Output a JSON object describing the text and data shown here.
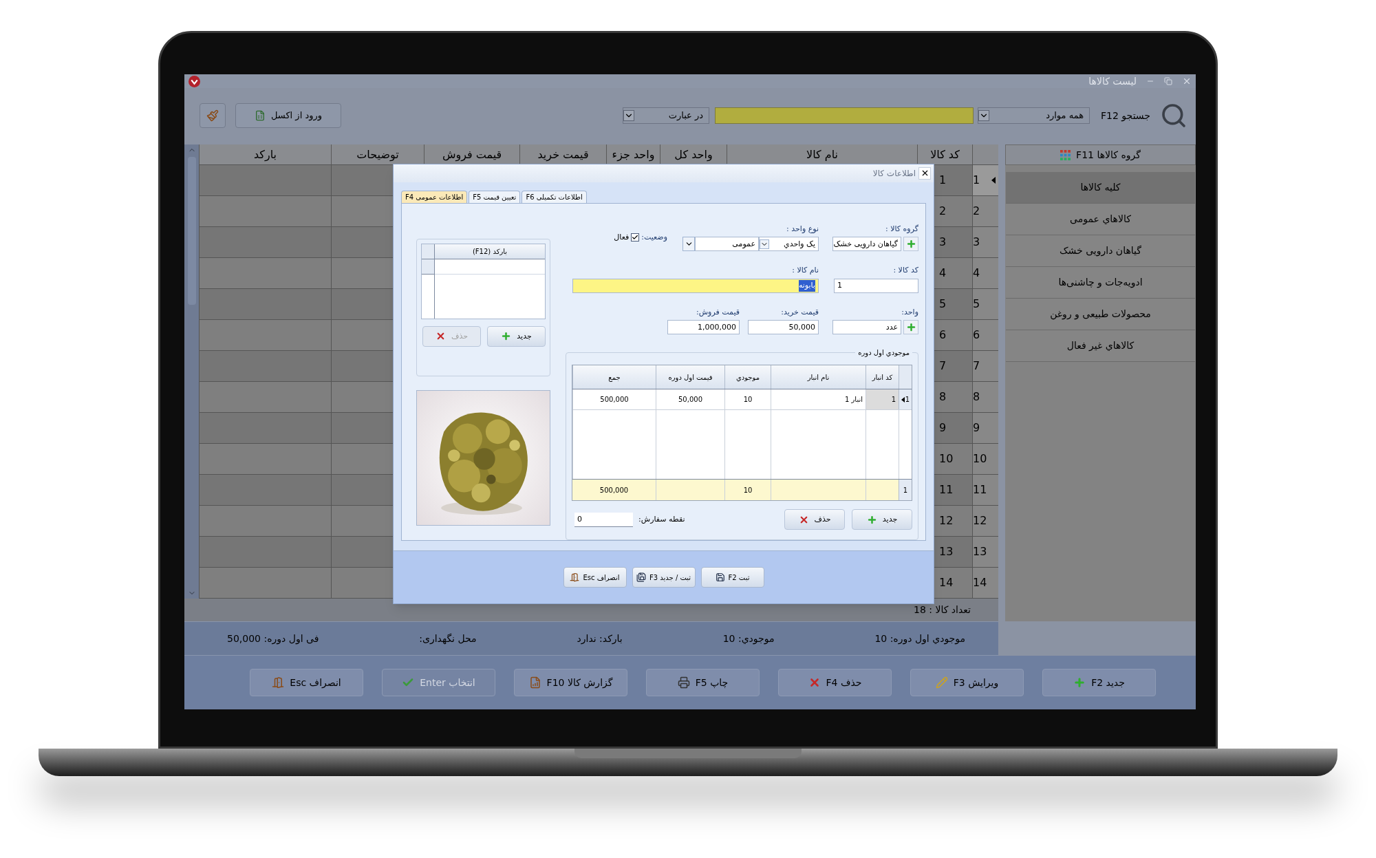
{
  "window": {
    "title": "لیست کالاها"
  },
  "toolbar": {
    "search_label": "جستجو F12",
    "scope": "همه موارد",
    "match": "در عبارت",
    "import_button": "ورود از اکسل"
  },
  "table": {
    "columns": [
      "کد کالا",
      "نام کالا",
      "واحد کل",
      "واحد جزء",
      "قیمت خرید",
      "قیمت فروش",
      "توضیحات",
      "بارکد"
    ],
    "rows": [
      {
        "number": "1",
        "code": "1",
        "selected": true
      },
      {
        "number": "2",
        "code": "2",
        "selected": false
      },
      {
        "number": "3",
        "code": "3",
        "selected": false
      },
      {
        "number": "4",
        "code": "4",
        "selected": false
      },
      {
        "number": "5",
        "code": "5",
        "selected": false
      },
      {
        "number": "6",
        "code": "6",
        "selected": false
      },
      {
        "number": "7",
        "code": "7",
        "selected": false
      },
      {
        "number": "8",
        "code": "8",
        "selected": false
      },
      {
        "number": "9",
        "code": "9",
        "selected": false
      },
      {
        "number": "10",
        "code": "10",
        "selected": false
      },
      {
        "number": "11",
        "code": "11",
        "selected": false
      },
      {
        "number": "12",
        "code": "12",
        "selected": false
      },
      {
        "number": "13",
        "code": "13",
        "selected": false
      },
      {
        "number": "14",
        "code": "14",
        "selected": false
      }
    ],
    "footer": "تعداد کالا : 18"
  },
  "sidebar": {
    "title": "گروه کالاها F11",
    "items": [
      {
        "label": "کلیه کالاها",
        "selected": true
      },
      {
        "label": "کالاهاي عمومی",
        "selected": false
      },
      {
        "label": "گیاهان دارویی خشک",
        "selected": false
      },
      {
        "label": "ادویه‌جات و چاشنی‌ها",
        "selected": false
      },
      {
        "label": "محصولات طبیعی و روغن",
        "selected": false
      },
      {
        "label": "کالاهاي غیر فعال",
        "selected": false
      }
    ]
  },
  "details": [
    "موجودي اول دوره: 10",
    "موجودي: 10",
    "بارکد: ندارد",
    "محل نگهداری:",
    "فی اول دوره: 50,000"
  ],
  "actions": [
    {
      "label": "جدید F2",
      "kind": "new",
      "disabled": false
    },
    {
      "label": "ویرایش F3",
      "kind": "edit",
      "disabled": false
    },
    {
      "label": "حذف F4",
      "kind": "delete",
      "disabled": false
    },
    {
      "label": "چاپ F5",
      "kind": "print",
      "disabled": false
    },
    {
      "label": "گزارش کالا F10",
      "kind": "report",
      "disabled": false
    },
    {
      "label": "انتخاب Enter",
      "kind": "select",
      "disabled": true
    },
    {
      "label": "انصراف Esc",
      "kind": "cancel",
      "disabled": false
    }
  ],
  "dialog": {
    "title": "اطلاعات کالا",
    "tabs": [
      {
        "label": "اطلاعات تکمیلی F6",
        "selected": false
      },
      {
        "label": "تعیین قیمت F5",
        "selected": false
      },
      {
        "label": "اطلاعات عمومی F4",
        "selected": true
      }
    ],
    "group": {
      "label": "گروه کالا :",
      "value": "گیاهان دارویی خشک"
    },
    "unit_type": {
      "label": "نوع واحد :",
      "value": "یک واحدي",
      "category": "عمومی"
    },
    "status": {
      "label": "وضعیت:",
      "option": "فعال",
      "checked": true
    },
    "code": {
      "label": "کد کالا :",
      "value": "1"
    },
    "name": {
      "label": "نام کالا :",
      "value": "بابونه",
      "text_selected": true
    },
    "unit": {
      "label": "واحد:",
      "value": "عدد"
    },
    "purchase_price": {
      "label": "قیمت خرید:",
      "value": "50,000"
    },
    "sale_price": {
      "label": "قیمت فروش:",
      "value": "1,000,000"
    },
    "opening_stock": {
      "title": "موجودي اول دوره",
      "columns": [
        "کد انبار",
        "نام انبار",
        "موجودي",
        "قیمت اول دوره",
        "جمع"
      ],
      "rows": [
        {
          "number": "1",
          "selected": true,
          "cells": [
            "1",
            "انبار 1",
            "10",
            "50,000",
            "500,000"
          ]
        }
      ],
      "totals": {
        "count": "1",
        "stock": "10",
        "sum": "500,000"
      },
      "buttons": [
        {
          "label": "جدید",
          "kind": "new",
          "disabled": false
        },
        {
          "label": "حذف",
          "kind": "delete",
          "disabled": false
        }
      ]
    },
    "reorder_point": {
      "label": "نقطه سفارش:",
      "value": "0"
    },
    "barcodes": {
      "column": "بارکد (F12)",
      "buttons": [
        {
          "label": "جدید",
          "kind": "new",
          "disabled": false
        },
        {
          "label": "حذف",
          "kind": "delete",
          "disabled": true
        }
      ]
    },
    "buttons": [
      {
        "label": "ثبت F2",
        "kind": "save"
      },
      {
        "label": "ثبت / جدید F3",
        "kind": "save_new"
      },
      {
        "label": "انصراف Esc",
        "kind": "cancel"
      }
    ]
  }
}
